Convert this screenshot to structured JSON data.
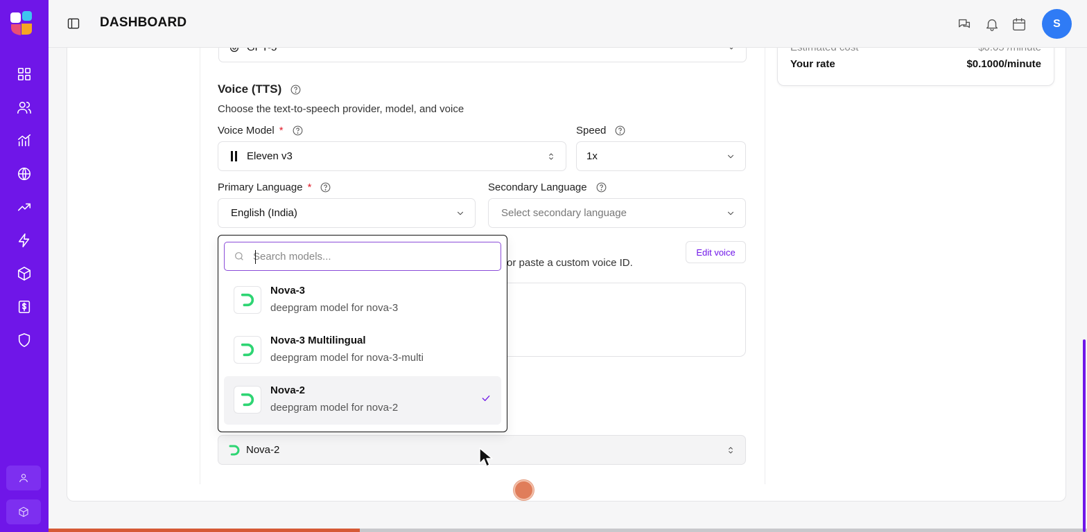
{
  "header": {
    "title": "DASHBOARD",
    "avatar_initial": "S"
  },
  "sidebar": {
    "items": [
      {
        "name": "dashboard-icon"
      },
      {
        "name": "users-icon"
      },
      {
        "name": "analytics-icon"
      },
      {
        "name": "globe-icon"
      },
      {
        "name": "trending-icon"
      },
      {
        "name": "lightning-icon"
      },
      {
        "name": "package-icon"
      },
      {
        "name": "billing-icon"
      },
      {
        "name": "shield-icon"
      }
    ]
  },
  "top_partial_select": {
    "value": "GPT-5"
  },
  "rate_card": {
    "faded_label": "Estimated cost",
    "faded_value": "$0.05 /minute",
    "rate_label": "Your rate",
    "rate_value": "$0.1000/minute"
  },
  "voice_section": {
    "heading": "Voice (TTS)",
    "description": "Choose the text-to-speech provider, model, and voice",
    "voice_model_label": "Voice Model",
    "voice_model_value": "Eleven v3",
    "speed_label": "Speed",
    "speed_value": "1x",
    "primary_language_label": "Primary Language",
    "primary_language_value": "English (India)",
    "secondary_language_label": "Secondary Language",
    "secondary_language_placeholder": "Select secondary language",
    "voice_desc_partial": "or paste a custom voice ID.",
    "edit_voice_label": "Edit voice"
  },
  "model_dropdown": {
    "search_placeholder": "Search models...",
    "options": [
      {
        "title": "Nova-3",
        "subtitle": "deepgram model for nova-3",
        "selected": false
      },
      {
        "title": "Nova-3 Multilingual",
        "subtitle": "deepgram model for nova-3-multi",
        "selected": false
      },
      {
        "title": "Nova-2",
        "subtitle": "deepgram model for nova-2",
        "selected": true
      }
    ],
    "current_value": "Nova-2"
  },
  "progress": {
    "fraction": 0.3
  },
  "colors": {
    "sidebar": "#6f16e8",
    "accent": "#6f16e8",
    "avatar": "#2f7bf5",
    "deepgram_green": "#2ed573",
    "record": "#e07d5a"
  }
}
